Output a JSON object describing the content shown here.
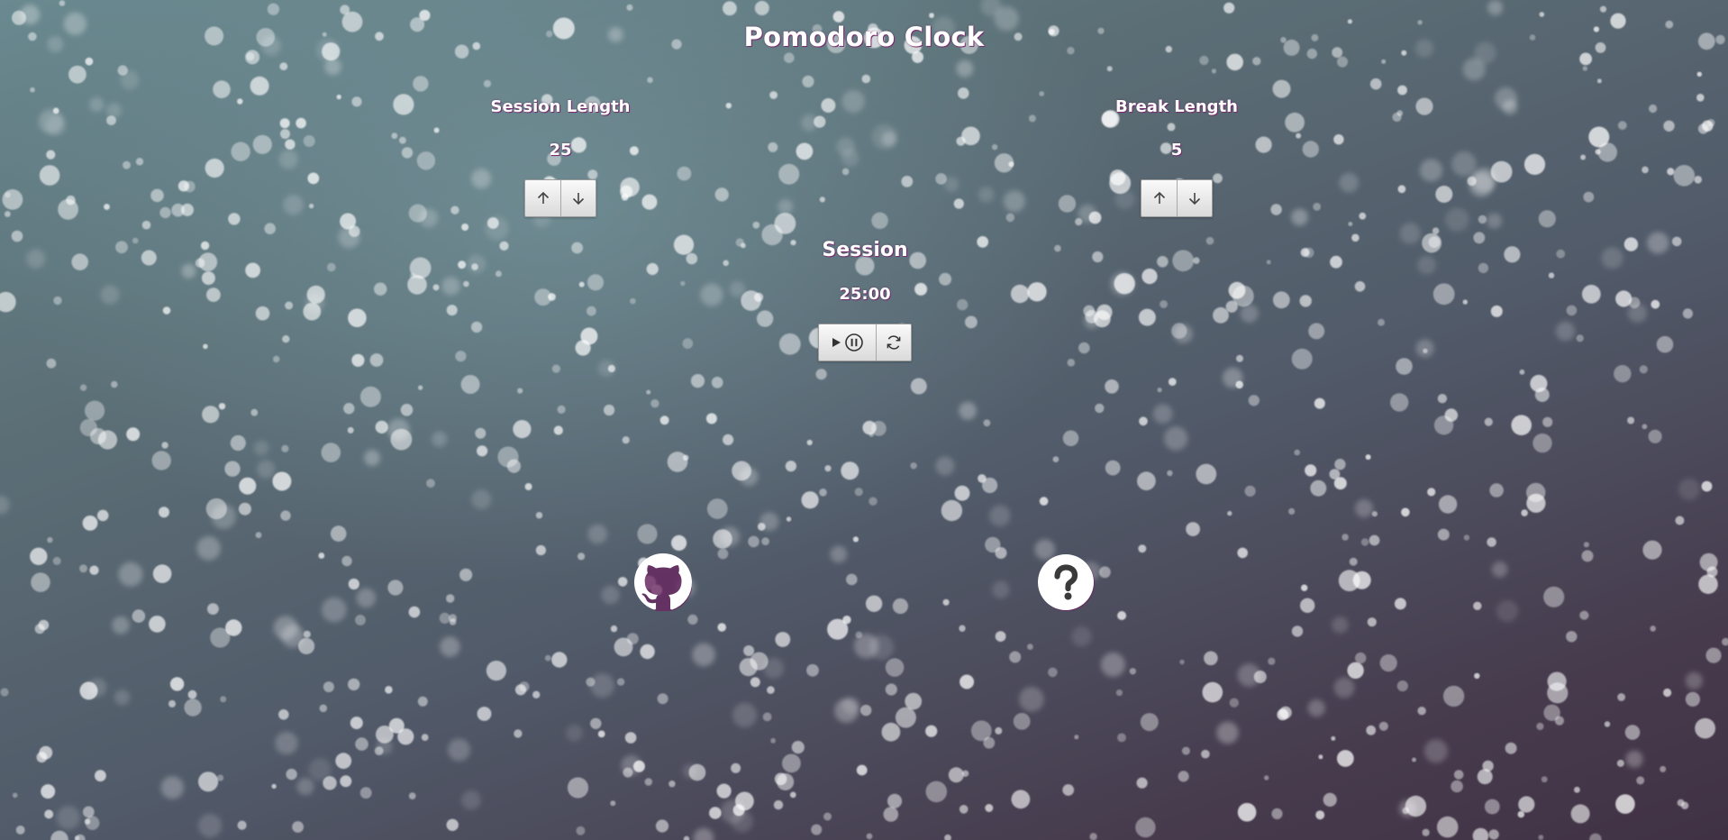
{
  "app": {
    "title": "Pomodoro Clock"
  },
  "session_length": {
    "label": "Session Length",
    "value": "25"
  },
  "break_length": {
    "label": "Break Length",
    "value": "5"
  },
  "timer": {
    "label": "Session",
    "time": "25:00"
  },
  "icons": {
    "increment": "arrow-up-icon",
    "decrement": "arrow-down-icon",
    "play": "play-icon",
    "pause": "pause-icon",
    "reset": "refresh-icon",
    "github": "github-icon",
    "help": "question-icon"
  },
  "colors": {
    "text": "#ffffff",
    "text_shadow": "#7a2a6e",
    "button_face": "#e9e9e9"
  }
}
